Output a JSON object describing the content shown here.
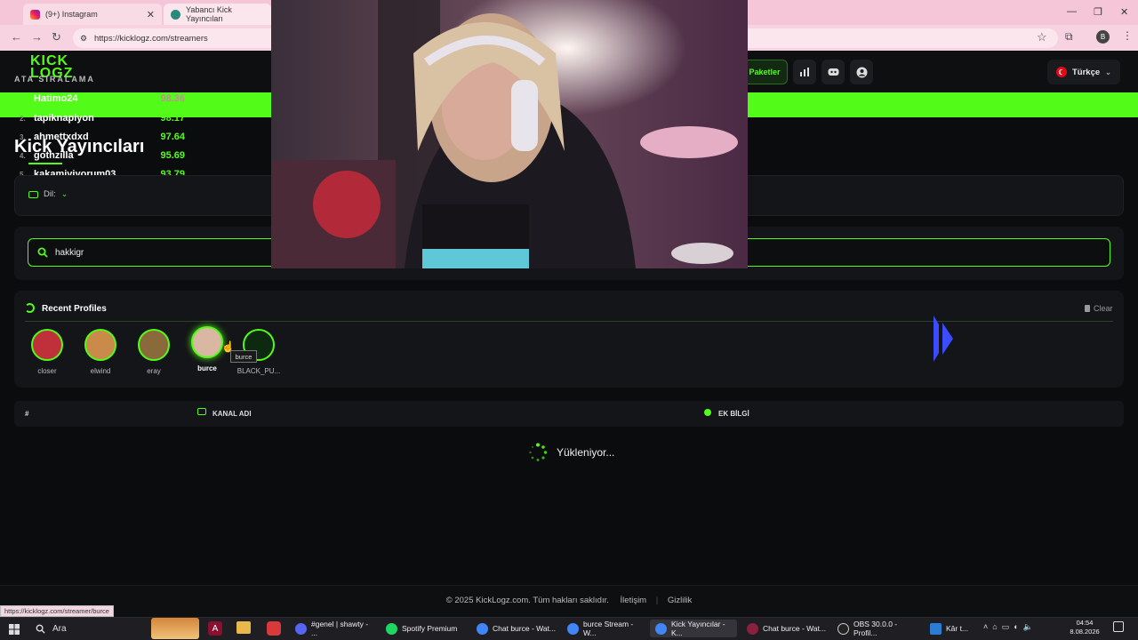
{
  "browser": {
    "tabs": [
      {
        "label": "(9+) Instagram"
      },
      {
        "label": "Yabancı Kick Yayıncıları"
      }
    ],
    "url": "https://kicklogz.com/streamers",
    "status_url": "https://kicklogz.com/streamer/burce"
  },
  "header": {
    "logo_line1": "KICK",
    "logo_line2": "LOGZ",
    "packages_label": "Paketler",
    "language_label": "Türkçe"
  },
  "overlay": {
    "label": "ATA SIRALAMA",
    "ranking": [
      {
        "num": "",
        "name": "Hatimo24",
        "score": "98.36"
      },
      {
        "num": "2.",
        "name": "tapiknapiyon",
        "score": "98.17"
      },
      {
        "num": "3.",
        "name": "ahmettxdxd",
        "score": "97.64"
      },
      {
        "num": "4.",
        "name": "gothzilla",
        "score": "95.69"
      },
      {
        "num": "5.",
        "name": "kakamiyiyorum03",
        "score": "93.79"
      }
    ]
  },
  "page": {
    "title": "Kick Yayıncıları",
    "filter_label": "Dil:"
  },
  "search": {
    "value": "hakkigr"
  },
  "recent": {
    "title": "Recent Profiles",
    "clear_label": "Clear",
    "tooltip": "burce",
    "profiles": [
      {
        "name": "closer",
        "color": "#c0303a"
      },
      {
        "name": "elwind",
        "color": "#c98a4a"
      },
      {
        "name": "eray",
        "color": "#8a6a3a"
      },
      {
        "name": "burce",
        "color": "#d9b7a3"
      },
      {
        "name": "BLACK_PU...",
        "color": "#0d2a10"
      }
    ]
  },
  "table": {
    "col_num": "#",
    "col_channel": "KANAL ADI",
    "col_info": "EK BİLGİ"
  },
  "loading": "Yükleniyor...",
  "footer": {
    "copyright": "© 2025 KickLogz.com. Tüm hakları saklıdır.",
    "contact": "İletişim",
    "privacy": "Gizlilik"
  },
  "taskbar": {
    "search": "Ara",
    "items": [
      {
        "label": "#genel | shawty - ...",
        "icon_color": "#5865f2"
      },
      {
        "label": "Spotify Premium",
        "icon_color": "#1ed760"
      },
      {
        "label": "Chat burce - Wat...",
        "icon_color": "#4285f4"
      },
      {
        "label": "burce Stream - W...",
        "icon_color": "#4285f4"
      },
      {
        "label": "Kick Yayıncılar - K...",
        "icon_color": "#4285f4"
      },
      {
        "label": "Chat burce - Wat...",
        "icon_color": "#8a2040"
      },
      {
        "label": "OBS 30.0.0 - Profil...",
        "icon_color": "#222222"
      },
      {
        "label": "Kâr t...",
        "icon_color": "#2b7cd3"
      }
    ],
    "time": "04:54",
    "date": "8.08.2026"
  },
  "colors": {
    "accent": "#53fc18",
    "background": "#0b0c0e",
    "panel": "#141518"
  }
}
